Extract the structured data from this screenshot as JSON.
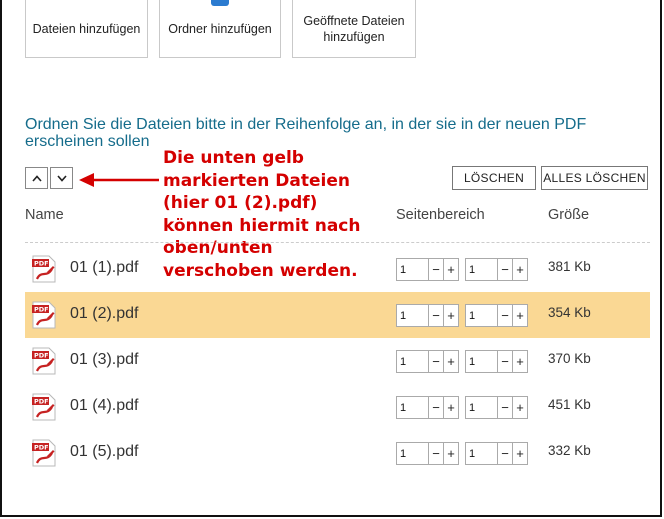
{
  "toolbar": {
    "add_files_label": "Dateien hinzufügen",
    "add_folder_label": "Ordner hinzufügen",
    "add_open_files_label": "Geöffnete Dateien hinzufügen"
  },
  "instruction": "Ordnen Sie die Dateien bitte in der Reihenfolge an, in der sie in der neuen PDF erscheinen sollen",
  "order_controls": {
    "up_icon": "chevron-up-icon",
    "down_icon": "chevron-down-icon"
  },
  "annotation": {
    "text": "Die unten gelb markierten Dateien (hier 01 (2).pdf) können hiermit nach oben/unten verschoben werden.",
    "color": "#d40000"
  },
  "actions": {
    "delete_label": "LÖSCHEN",
    "delete_all_label": "ALLES LÖSCHEN"
  },
  "columns": {
    "name": "Name",
    "page_range": "Seitenbereich",
    "size": "Größe"
  },
  "colors": {
    "accent": "#156c8b",
    "selected_row": "#fad894",
    "annotation": "#d40000"
  },
  "files": [
    {
      "name": "01 (1).pdf",
      "from": "1",
      "to": "1",
      "size": "381 Kb",
      "selected": false
    },
    {
      "name": "01 (2).pdf",
      "from": "1",
      "to": "1",
      "size": "354 Kb",
      "selected": true
    },
    {
      "name": "01 (3).pdf",
      "from": "1",
      "to": "1",
      "size": "370 Kb",
      "selected": false
    },
    {
      "name": "01 (4).pdf",
      "from": "1",
      "to": "1",
      "size": "451 Kb",
      "selected": false
    },
    {
      "name": "01 (5).pdf",
      "from": "1",
      "to": "1",
      "size": "332 Kb",
      "selected": false
    }
  ],
  "stepper_glyphs": {
    "minus": "−",
    "plus": "+"
  }
}
